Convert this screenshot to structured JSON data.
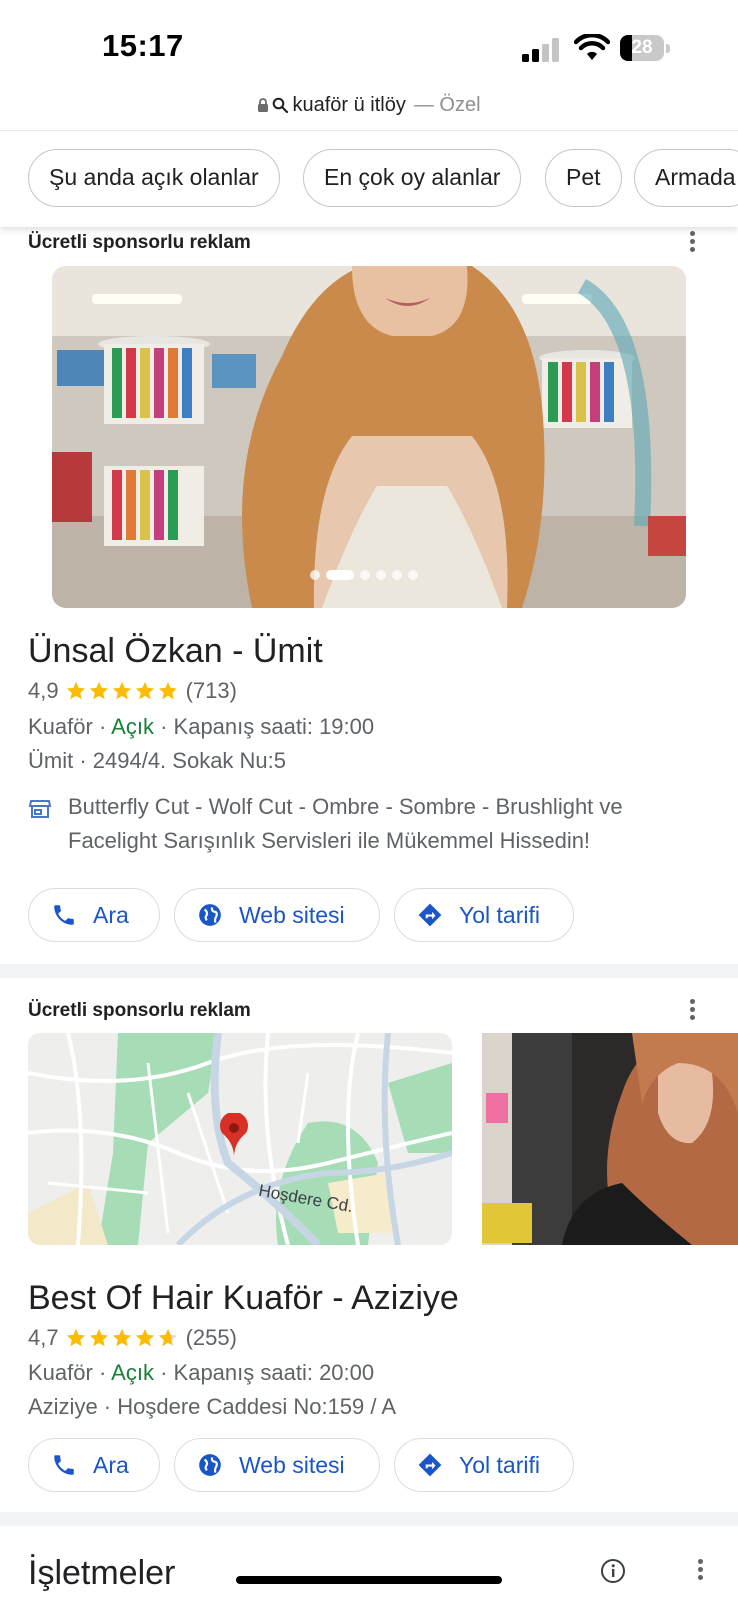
{
  "status_bar": {
    "time": "15:17",
    "battery": "28",
    "battery_level": 0.28
  },
  "url_bar": {
    "query": "kuaför ü itlöy",
    "suffix": "— Özel"
  },
  "chips": [
    "Şu anda açık olanlar",
    "En çok oy alanlar",
    "Pet",
    "Armada"
  ],
  "listings": [
    {
      "sponsored_label": "Ücretli sponsorlu reklam",
      "name": "Ünsal Özkan - Ümit",
      "rating": "4,9",
      "stars": 4.9,
      "reviews": "(713)",
      "category": "Kuaför",
      "open_status": "Açık",
      "closing": "Kapanış saati: 19:00",
      "address": "Ümit · 2494/4. Sokak Nu:5",
      "description": "Butterfly Cut - Wolf Cut - Ombre - Sombre - Brushlight ve Facelight Sarışınlık Servisleri ile Mükemmel Hissedin!",
      "actions": {
        "call": "Ara",
        "website": "Web sitesi",
        "directions": "Yol tarifi"
      }
    },
    {
      "sponsored_label": "Ücretli sponsorlu reklam",
      "name": "Best Of Hair Kuaför - Aziziye",
      "rating": "4,7",
      "stars": 4.7,
      "reviews": "(255)",
      "category": "Kuaför",
      "open_status": "Açık",
      "closing": "Kapanış saati: 20:00",
      "address": "Aziziye · Hoşdere Caddesi No:159 / A",
      "map_label": "Hoşdere Cd.",
      "actions": {
        "call": "Ara",
        "website": "Web sitesi",
        "directions": "Yol tarifi"
      }
    }
  ],
  "section": {
    "title": "İşletmeler"
  },
  "colors": {
    "link_blue": "#1a56c8",
    "open_green": "#188038",
    "star_yellow": "#fbbc04",
    "pin_red": "#d93025"
  }
}
